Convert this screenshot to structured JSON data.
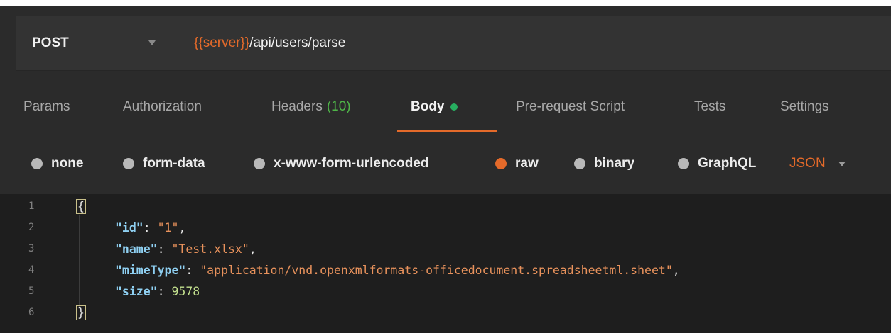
{
  "request": {
    "method": "POST",
    "url_variable": "{{server}}",
    "url_path": "/api/users/parse"
  },
  "tabs": [
    {
      "label": "Params"
    },
    {
      "label": "Authorization"
    },
    {
      "label": "Headers",
      "count": "(10)"
    },
    {
      "label": "Body"
    },
    {
      "label": "Pre-request Script"
    },
    {
      "label": "Tests"
    },
    {
      "label": "Settings"
    }
  ],
  "body_types": [
    {
      "label": "none"
    },
    {
      "label": "form-data"
    },
    {
      "label": "x-www-form-urlencoded"
    },
    {
      "label": "raw"
    },
    {
      "label": "binary"
    },
    {
      "label": "GraphQL"
    }
  ],
  "raw_format": "JSON",
  "editor": {
    "line_numbers": [
      "1",
      "2",
      "3",
      "4",
      "5",
      "6"
    ],
    "open_brace": "{",
    "close_brace": "}",
    "entries": [
      {
        "key": "\"id\"",
        "sep": ": ",
        "value": "\"1\"",
        "trail": ","
      },
      {
        "key": "\"name\"",
        "sep": ": ",
        "value": "\"Test.xlsx\"",
        "trail": ","
      },
      {
        "key": "\"mimeType\"",
        "sep": ": ",
        "value": "\"application/vnd.openxmlformats-officedocument.spreadsheetml.sheet\"",
        "trail": ","
      },
      {
        "key": "\"size\"",
        "sep": ": ",
        "value": "9578",
        "trail": ""
      }
    ]
  },
  "colors": {
    "accent": "#e46a2a",
    "active_dot": "#27ae60",
    "headers_count": "#4fb548",
    "background": "#2b2b2b",
    "editor_background": "#1e1e1e"
  }
}
